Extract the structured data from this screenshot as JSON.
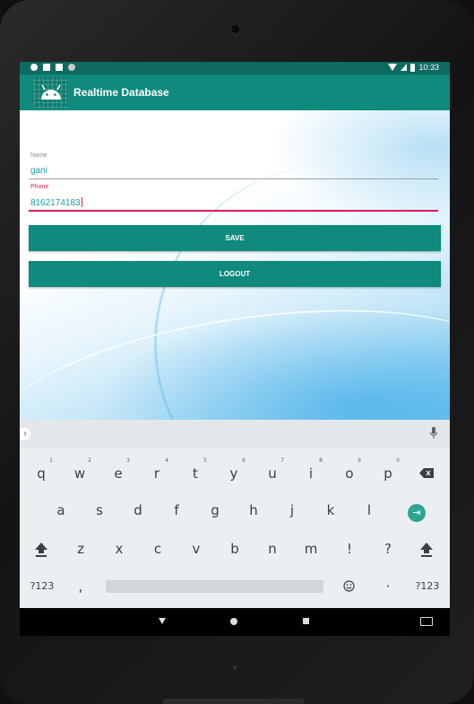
{
  "status_bar": {
    "time": "10:33"
  },
  "app_bar": {
    "title": "Realtime Database"
  },
  "form": {
    "name_label": "Name",
    "name_value": "gani",
    "phone_label": "Phone",
    "phone_value": "8162174183",
    "save_label": "SAVE",
    "logout_label": "LOGOUT"
  },
  "colors": {
    "primary": "#0f8a7c",
    "status_bar": "#0d6b60",
    "accent": "#d81b60",
    "input_text": "#1ba0a8"
  },
  "keyboard": {
    "row1": [
      "q",
      "w",
      "e",
      "r",
      "t",
      "y",
      "u",
      "i",
      "o",
      "p"
    ],
    "row1_hints": [
      "1",
      "2",
      "3",
      "4",
      "5",
      "6",
      "7",
      "8",
      "9",
      "0"
    ],
    "row2": [
      "a",
      "s",
      "d",
      "f",
      "g",
      "h",
      "j",
      "k",
      "l"
    ],
    "row3": [
      "z",
      "x",
      "c",
      "v",
      "b",
      "n",
      "m",
      "!",
      "?"
    ],
    "bottom_left": "?123",
    "comma": ",",
    "period": "·",
    "bottom_right": "?123",
    "enter_glyph": "⇥",
    "backspace_icon": "backspace-icon",
    "shift_icon": "shift-icon",
    "emoji_icon": "emoji-icon",
    "mic_icon": "mic-icon"
  }
}
